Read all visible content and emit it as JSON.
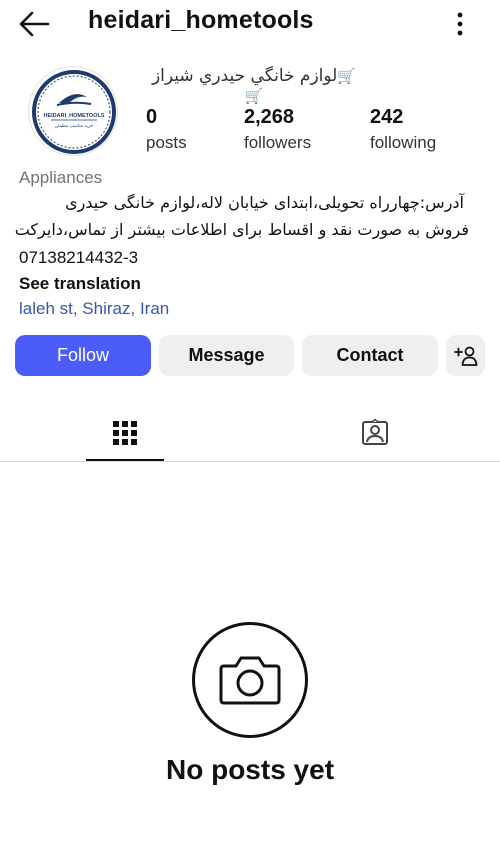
{
  "header": {
    "username": "heidari_hometools",
    "back_icon": "arrow-left-icon",
    "menu_icon": "vertical-dots-icon"
  },
  "profile": {
    "avatar_logo_text": "HEIDARI_HOMETOOLS",
    "avatar_logo_subtext": "خرید مناسب مطمئن",
    "display_name_prefix": "🛒",
    "display_name_text": "لوازم خانگي حيدري شيراز",
    "display_name_suffix": "🛒",
    "stats": [
      {
        "value": "0",
        "label": "posts"
      },
      {
        "value": "2,268",
        "label": "followers"
      },
      {
        "value": "242",
        "label": "following"
      }
    ],
    "category": "Appliances",
    "bio_line1": "آدرس:چهارراه تحویلی،ابتدای خیابان لاله،لوازم خانگی حیدری",
    "bio_line2": "فروش به صورت نقد و اقساط برای اطلاعات بیشتر از تماس،دایرکت",
    "phone": "07138214432-3",
    "see_translation": "See translation",
    "location": "laleh st, Shiraz, Iran"
  },
  "actions": {
    "follow": "Follow",
    "message": "Message",
    "contact": "Contact",
    "add_user_icon": "add-person-icon"
  },
  "tabs": [
    {
      "icon": "grid-icon",
      "active": true
    },
    {
      "icon": "tagged-person-icon",
      "active": false
    }
  ],
  "empty_state": {
    "icon": "camera-icon",
    "text": "No posts yet"
  },
  "colors": {
    "follow_button": "#4a5df9",
    "location_link": "#3855b3",
    "secondary_button": "#efefef",
    "muted_text": "#737373"
  }
}
